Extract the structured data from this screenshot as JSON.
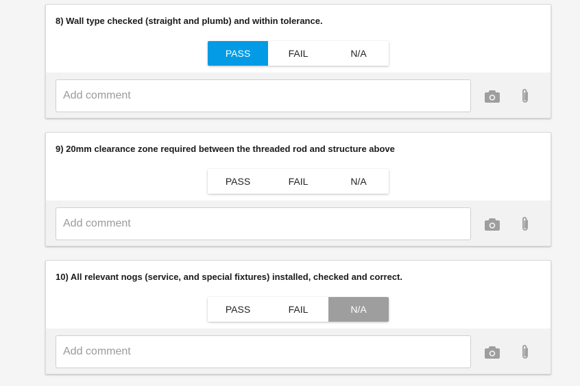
{
  "colors": {
    "pass_active": "#039be5",
    "na_active": "#9e9e9e",
    "icon": "#9e9e9e"
  },
  "items": [
    {
      "title": "8) Wall type checked (straight and plumb) and within tolerance.",
      "options": [
        "PASS",
        "FAIL",
        "N/A"
      ],
      "selected": "PASS",
      "comment_placeholder": "Add comment",
      "comment_value": "",
      "icons": [
        "camera-icon",
        "paperclip-icon"
      ]
    },
    {
      "title": "9) 20mm clearance zone required between the threaded rod and structure above",
      "options": [
        "PASS",
        "FAIL",
        "N/A"
      ],
      "selected": "",
      "comment_placeholder": "Add comment",
      "comment_value": "",
      "icons": [
        "camera-icon",
        "paperclip-icon"
      ]
    },
    {
      "title": "10) All relevant nogs (service, and special fixtures) installed, checked and correct.",
      "options": [
        "PASS",
        "FAIL",
        "N/A"
      ],
      "selected": "N/A",
      "comment_placeholder": "Add comment",
      "comment_value": "",
      "icons": [
        "camera-icon",
        "paperclip-icon"
      ]
    }
  ]
}
